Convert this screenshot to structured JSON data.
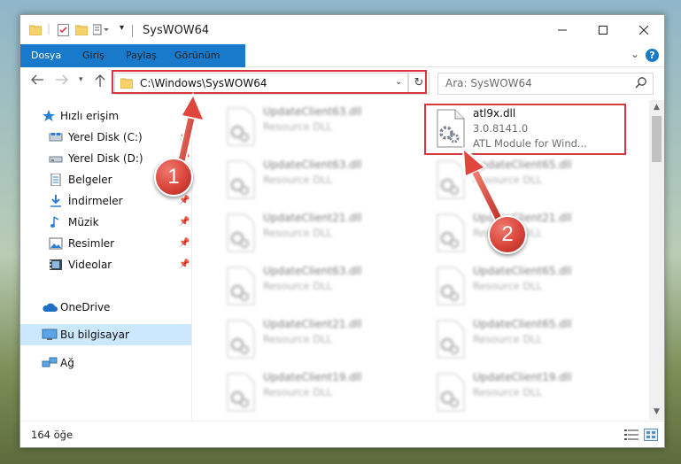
{
  "window": {
    "title": "SysWOW64",
    "controls": [
      "minimize",
      "maximize",
      "close"
    ]
  },
  "ribbon": {
    "tabs": [
      "Dosya",
      "Giriş",
      "Paylaş",
      "Görünüm"
    ],
    "help": "?",
    "file_tab_color": "#1979ca"
  },
  "navigation": {
    "address": "C:\\Windows\\SysWOW64",
    "search_placeholder": "Ara: SysWOW64"
  },
  "sidebar": {
    "items": [
      {
        "label": "Hızlı erişim",
        "icon": "star-icon"
      },
      {
        "label": "Yerel Disk (C:)",
        "icon": "drive-icon",
        "pinned": true
      },
      {
        "label": "Yerel Disk (D:)",
        "icon": "drive-icon",
        "pinned": true
      },
      {
        "label": "Belgeler",
        "icon": "document-icon",
        "pinned": true
      },
      {
        "label": "İndirmeler",
        "icon": "download-icon",
        "pinned": true
      },
      {
        "label": "Müzik",
        "icon": "music-icon",
        "pinned": true
      },
      {
        "label": "Resimler",
        "icon": "pictures-icon",
        "pinned": true
      },
      {
        "label": "Videolar",
        "icon": "video-icon",
        "pinned": true
      },
      {
        "label": "OneDrive",
        "icon": "cloud-icon"
      },
      {
        "label": "Bu bilgisayar",
        "icon": "computer-icon",
        "selected": true
      },
      {
        "label": "Ağ",
        "icon": "network-icon"
      }
    ]
  },
  "files": {
    "left_column": [
      {
        "name": "UpdateClient63.dll",
        "type": "Resource DLL"
      },
      {
        "name": "UpdateClient63.dll",
        "type": "Resource DLL"
      },
      {
        "name": "UpdateClient21.dll",
        "type": "Resource DLL"
      },
      {
        "name": "UpdateClient63.dll",
        "type": "Resource DLL"
      },
      {
        "name": "UpdateClient21.dll",
        "type": "Resource DLL"
      },
      {
        "name": "UpdateClient19.dll",
        "type": "Resource DLL"
      }
    ],
    "highlighted": {
      "name": "atl9x.dll",
      "version": "3.0.8141.0",
      "description": "ATL Module for Wind..."
    },
    "right_column": [
      {
        "name": "UpdateClient65.dll",
        "type": "Resource DLL"
      },
      {
        "name": "UpdateClient21.dll",
        "type": "Resource DLL"
      },
      {
        "name": "UpdateClient65.dll",
        "type": "Resource DLL"
      },
      {
        "name": "UpdateClient65.dll",
        "type": "Resource DLL"
      },
      {
        "name": "UpdateClient19.dll",
        "type": "Resource DLL"
      }
    ]
  },
  "status": {
    "item_count": "164 öğe"
  },
  "annotations": {
    "callout_1": "1",
    "callout_2": "2",
    "accent_color": "#d9363e"
  }
}
